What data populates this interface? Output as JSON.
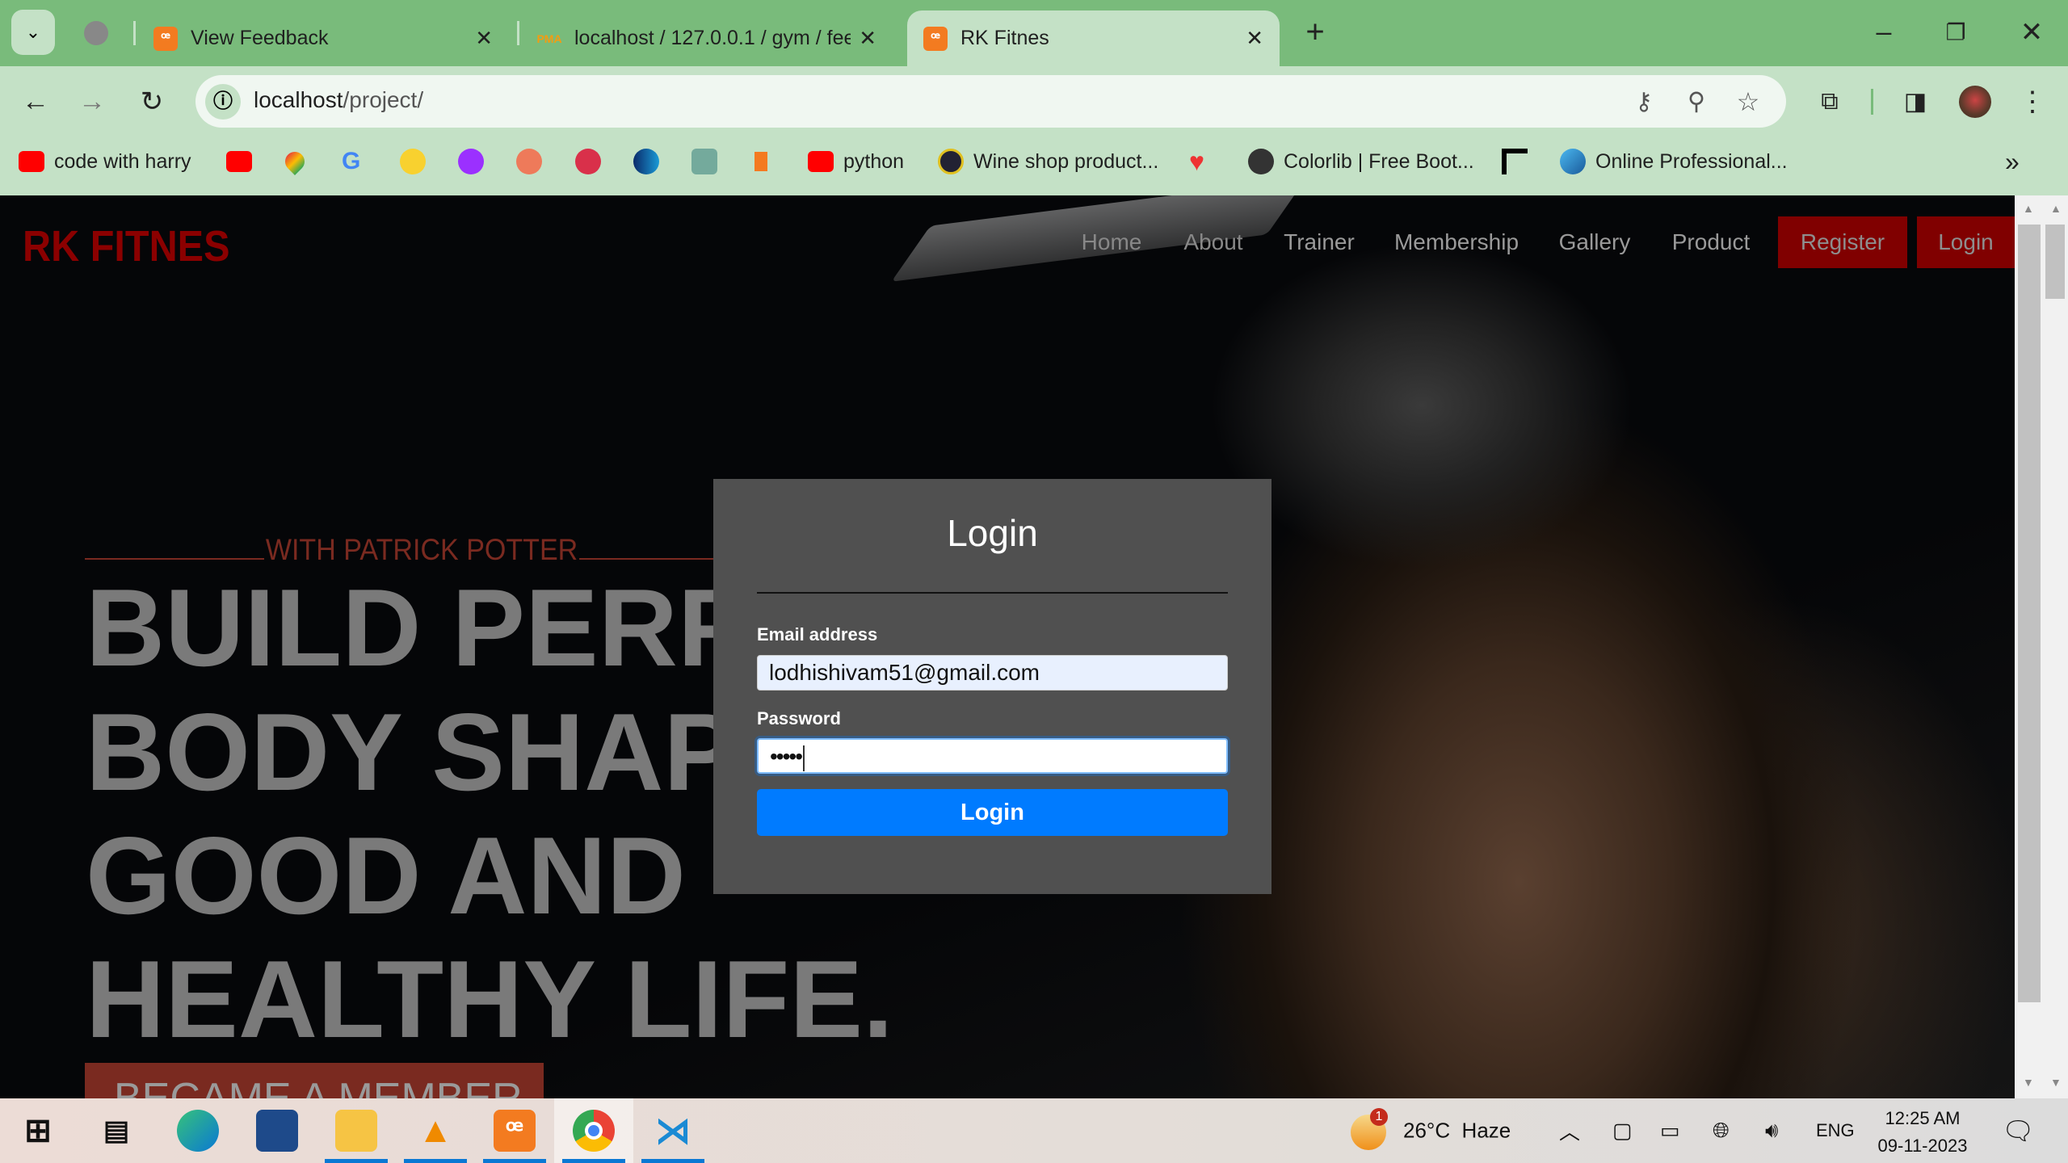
{
  "browser": {
    "tabs": [
      {
        "title": "View Feedback",
        "icon": "xampp-icon",
        "active": false
      },
      {
        "title": "localhost / 127.0.0.1 / gym / fee",
        "icon": "phpmyadmin-icon",
        "active": false
      },
      {
        "title": "RK Fitnes",
        "icon": "xampp-icon",
        "active": true
      }
    ],
    "url_host": "localhost",
    "url_path": "/project/",
    "bookmarks": [
      {
        "label": "code with harry",
        "icon": "youtube-icon"
      },
      {
        "label": "",
        "icon": "youtube-icon"
      },
      {
        "label": "",
        "icon": "google-maps-icon"
      },
      {
        "label": "",
        "icon": "google-icon"
      },
      {
        "label": "",
        "icon": "flipkart-icon"
      },
      {
        "label": "",
        "icon": "u-icon"
      },
      {
        "label": "",
        "icon": "orange-blob-icon"
      },
      {
        "label": "",
        "icon": "red-blob-icon"
      },
      {
        "label": "",
        "icon": "blue-circle-icon"
      },
      {
        "label": "",
        "icon": "chatgpt-icon"
      },
      {
        "label": "",
        "icon": "orange-shape-icon"
      },
      {
        "label": "python",
        "icon": "youtube-icon"
      },
      {
        "label": "Wine shop product...",
        "icon": "wine-icon"
      },
      {
        "label": "",
        "icon": "heart-icon"
      },
      {
        "label": "Colorlib | Free Boot...",
        "icon": "globe-icon"
      },
      {
        "label": "",
        "icon": "f-logo-icon"
      },
      {
        "label": "Online Professional...",
        "icon": "feather-icon"
      }
    ],
    "more_bookmarks": "»"
  },
  "site": {
    "brand": "RK FITNES",
    "nav": [
      "Home",
      "About",
      "Trainer",
      "Membership",
      "Gallery",
      "Product"
    ],
    "register": "Register",
    "login": "Login",
    "subtitle": "WITH PATRICK POTTER",
    "headline": [
      "BUILD PERFECT",
      "BODY SHAPE FOR",
      "GOOD AND",
      "HEALTHY LIFE."
    ],
    "cta": "BECAME A MEMBER",
    "colors": {
      "brand": "#8b0000",
      "accent": "#7a2a20",
      "primary": "#007bff"
    }
  },
  "modal": {
    "title": "Login",
    "email_label": "Email address",
    "email_value": "lodhishivam51@gmail.com",
    "password_label": "Password",
    "password_value": "•••••",
    "submit": "Login"
  },
  "taskbar": {
    "weather": "26°C  Haze",
    "weather_badge": "1",
    "lang": "ENG",
    "time": "12:25 AM",
    "date": "09-11-2023"
  }
}
